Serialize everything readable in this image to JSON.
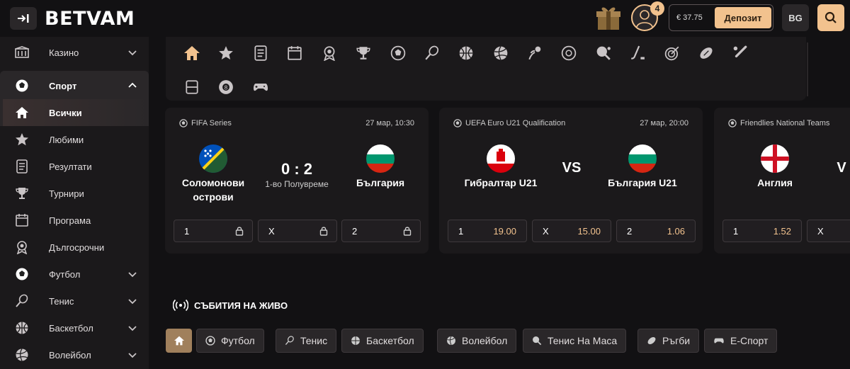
{
  "header": {
    "logo": "BETVAM",
    "notification_count": "4",
    "balance": "€ 37.75",
    "deposit_label": "Депозит",
    "language": "BG"
  },
  "sidebar": {
    "items": [
      {
        "label": "Казино",
        "icon": "casino-icon"
      },
      {
        "label": "Спорт",
        "icon": "soccer-ball-icon"
      },
      {
        "label": "Всички",
        "icon": "home-icon"
      },
      {
        "label": "Любими",
        "icon": "star-icon"
      },
      {
        "label": "Резултати",
        "icon": "document-icon"
      },
      {
        "label": "Турнири",
        "icon": "trophy-icon"
      },
      {
        "label": "Програма",
        "icon": "calendar-icon"
      },
      {
        "label": "Дългосрочни",
        "icon": "medal-icon"
      },
      {
        "label": "Футбол",
        "icon": "soccer-ball-icon"
      },
      {
        "label": "Тенис",
        "icon": "tennis-icon"
      },
      {
        "label": "Баскетбол",
        "icon": "basketball-icon"
      },
      {
        "label": "Волейбол",
        "icon": "volleyball-icon"
      }
    ]
  },
  "matches": [
    {
      "league": "FIFA Series",
      "date": "27 мар, 10:30",
      "home": "Соломонови острови",
      "away": "България",
      "score": "0 : 2",
      "period": "1-во Полувреме",
      "odds": [
        {
          "label": "1",
          "value": ""
        },
        {
          "label": "X",
          "value": ""
        },
        {
          "label": "2",
          "value": ""
        }
      ]
    },
    {
      "league": "UEFA Euro U21 Qualification",
      "date": "27 мар, 20:00",
      "home": "Гибралтар U21",
      "away": "България U21",
      "vs": "VS",
      "odds": [
        {
          "label": "1",
          "value": "19.00"
        },
        {
          "label": "X",
          "value": "15.00"
        },
        {
          "label": "2",
          "value": "1.06"
        }
      ]
    },
    {
      "league": "Friendlies National Teams",
      "home": "Англия",
      "vs": "V",
      "odds": [
        {
          "label": "1",
          "value": "1.52"
        },
        {
          "label": "X",
          "value": ""
        }
      ]
    }
  ],
  "live": {
    "title": "СЪБИТИЯ НА ЖИВО",
    "tabs": [
      "Футбол",
      "Тенис",
      "Баскетбол",
      "Волейбол",
      "Тенис На Маса",
      "Ръгби",
      "Е-Спорт"
    ]
  },
  "colors": {
    "accent": "#f2c28e",
    "bg": "#121113",
    "panel": "#1b191b"
  }
}
